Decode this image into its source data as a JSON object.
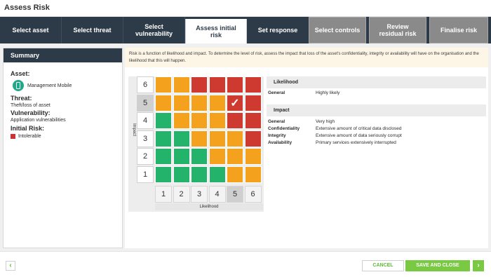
{
  "window": {
    "title": "Assess Risk"
  },
  "steps": [
    {
      "label": "Select asset",
      "state": "done"
    },
    {
      "label": "Select threat",
      "state": "done"
    },
    {
      "label": "Select vulnerability",
      "state": "done"
    },
    {
      "label": "Assess initial risk",
      "state": "active"
    },
    {
      "label": "Set response",
      "state": "done"
    },
    {
      "label": "Select controls",
      "state": "future"
    },
    {
      "label": "Review residual risk",
      "state": "future"
    },
    {
      "label": "Finalise risk",
      "state": "future"
    }
  ],
  "summary": {
    "header": "Summary",
    "asset_label": "Asset:",
    "asset_value": "Management Mobile",
    "threat_label": "Threat:",
    "threat_value": "Theft/loss of asset",
    "vulnerability_label": "Vulnerability:",
    "vulnerability_value": "Application vulnerabilities",
    "initial_risk_label": "Initial Risk:",
    "initial_risk_value": "Intolerable",
    "initial_risk_color": "#d22f2f"
  },
  "info_text": "Risk is a function of likelihood and impact. To determine the level of risk, assess the impact that loss of the asset's confidentiality, integrity or availability will have on the organisation and the likelihood that this will happen.",
  "matrix": {
    "impact_axis_label": "Impact",
    "likelihood_axis_label": "Likelihood",
    "rows": [
      "6",
      "5",
      "4",
      "3",
      "2",
      "1"
    ],
    "cols": [
      "1",
      "2",
      "3",
      "4",
      "5",
      "6"
    ],
    "selected_impact": 5,
    "selected_likelihood": 5,
    "grid": [
      [
        "o",
        "o",
        "r",
        "r",
        "r",
        "r"
      ],
      [
        "o",
        "o",
        "o",
        "o",
        "r",
        "r"
      ],
      [
        "g",
        "o",
        "o",
        "o",
        "r",
        "r"
      ],
      [
        "g",
        "g",
        "o",
        "o",
        "o",
        "r"
      ],
      [
        "g",
        "g",
        "g",
        "o",
        "o",
        "o"
      ],
      [
        "g",
        "g",
        "g",
        "g",
        "o",
        "o"
      ]
    ],
    "colors": {
      "g": "#24b36b",
      "o": "#f4a21e",
      "r": "#cf3a30"
    }
  },
  "likelihood_panel": {
    "title": "Likelihood",
    "rows": [
      {
        "key": "General",
        "value": "Highly likely"
      }
    ]
  },
  "impact_panel": {
    "title": "Impact",
    "rows": [
      {
        "key": "General",
        "value": "Very high"
      },
      {
        "key": "Confidentiality",
        "value": "Extensive amount of critical data disclosed"
      },
      {
        "key": "Integrity",
        "value": "Extensive amount of data seriously corrupt"
      },
      {
        "key": "Availability",
        "value": "Primary services extensively interrupted"
      }
    ]
  },
  "footer": {
    "back_icon": "chevron-left-icon",
    "back_glyph": "‹",
    "cancel_label": "CANCEL",
    "save_label": "SAVE AND CLOSE",
    "next_icon": "chevron-right-icon",
    "next_glyph": "›"
  }
}
